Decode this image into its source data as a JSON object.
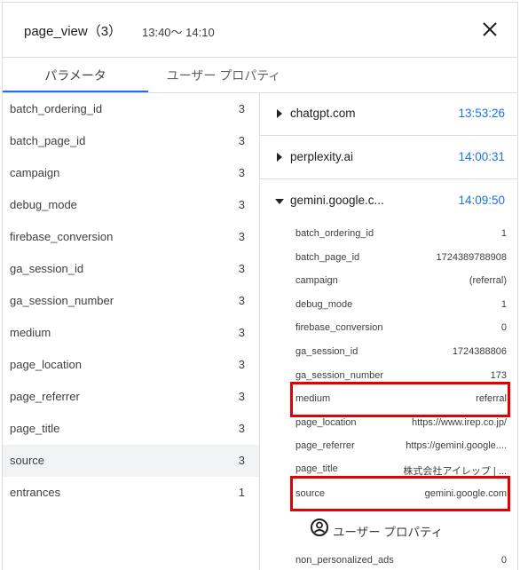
{
  "header": {
    "title": "page_view（3）",
    "time_range": "13:40〜 14:10",
    "close_icon": "close-icon"
  },
  "tabs": [
    {
      "label": "パラメータ",
      "active": true
    },
    {
      "label": "ユーザー プロパティ",
      "active": false
    }
  ],
  "params": [
    {
      "name": "batch_ordering_id",
      "count": "3"
    },
    {
      "name": "batch_page_id",
      "count": "3"
    },
    {
      "name": "campaign",
      "count": "3"
    },
    {
      "name": "debug_mode",
      "count": "3"
    },
    {
      "name": "firebase_conversion",
      "count": "3"
    },
    {
      "name": "ga_session_id",
      "count": "3"
    },
    {
      "name": "ga_session_number",
      "count": "3"
    },
    {
      "name": "medium",
      "count": "3"
    },
    {
      "name": "page_location",
      "count": "3"
    },
    {
      "name": "page_referrer",
      "count": "3"
    },
    {
      "name": "page_title",
      "count": "3"
    },
    {
      "name": "source",
      "count": "3",
      "selected": true
    },
    {
      "name": "entrances",
      "count": "1"
    }
  ],
  "events": [
    {
      "domain": "chatgpt.com",
      "time": "13:53:26",
      "expanded": false
    },
    {
      "domain": "perplexity.ai",
      "time": "14:00:31",
      "expanded": false
    },
    {
      "domain": "gemini.google.c...",
      "time": "14:09:50",
      "expanded": true
    }
  ],
  "details": [
    {
      "key": "batch_ordering_id",
      "value": "1"
    },
    {
      "key": "batch_page_id",
      "value": "1724389788908"
    },
    {
      "key": "campaign",
      "value": "(referral)"
    },
    {
      "key": "debug_mode",
      "value": "1"
    },
    {
      "key": "firebase_conversion",
      "value": "0"
    },
    {
      "key": "ga_session_id",
      "value": "1724388806"
    },
    {
      "key": "ga_session_number",
      "value": "173"
    },
    {
      "key": "medium",
      "value": "referral",
      "highlighted": true
    },
    {
      "key": "page_location",
      "value": "https://www.irep.co.jp/"
    },
    {
      "key": "page_referrer",
      "value": "https://gemini.google...."
    },
    {
      "key": "page_title",
      "value": "株式会社アイレップ | ..."
    },
    {
      "key": "source",
      "value": "gemini.google.com",
      "highlighted": true
    }
  ],
  "user_properties": {
    "label": "ユーザー プロパティ",
    "icon": "account-circle-icon",
    "items": [
      {
        "key": "non_personalized_ads",
        "value": "0"
      }
    ]
  },
  "colors": {
    "accent": "#1a73e8",
    "highlight": "#e30000",
    "selected_row": "#f1f3f4",
    "divider": "#dadce0"
  }
}
